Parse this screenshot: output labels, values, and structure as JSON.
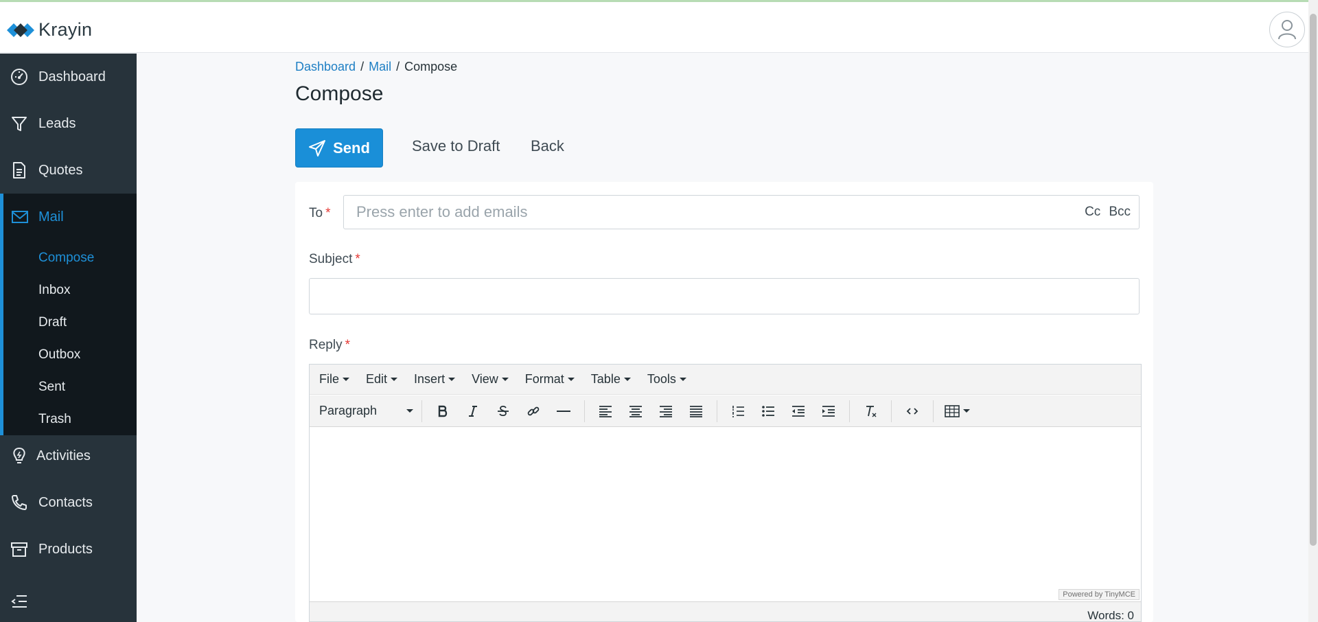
{
  "app": {
    "brand": "Krayin"
  },
  "sidebar": {
    "items": [
      {
        "label": "Dashboard",
        "icon": "dashboard-gauge-icon"
      },
      {
        "label": "Leads",
        "icon": "filter-icon"
      },
      {
        "label": "Quotes",
        "icon": "document-icon"
      },
      {
        "label": "Mail",
        "icon": "mail-icon"
      },
      {
        "label": "Activities",
        "icon": "lightbulb-icon"
      },
      {
        "label": "Contacts",
        "icon": "phone-icon"
      },
      {
        "label": "Products",
        "icon": "archive-box-icon"
      }
    ],
    "mail_sub": [
      "Compose",
      "Inbox",
      "Draft",
      "Outbox",
      "Sent",
      "Trash"
    ],
    "active_sub": "Compose"
  },
  "breadcrumb": {
    "home": "Dashboard",
    "section": "Mail",
    "current": "Compose",
    "sep": "/"
  },
  "page": {
    "title": "Compose"
  },
  "actions": {
    "send": "Send",
    "save_draft": "Save to Draft",
    "back": "Back"
  },
  "form": {
    "to_label": "To",
    "to_placeholder": "Press enter to add emails",
    "cc": "Cc",
    "bcc": "Bcc",
    "subject_label": "Subject",
    "subject_value": "",
    "reply_label": "Reply",
    "required_mark": "*"
  },
  "editor": {
    "menus": [
      "File",
      "Edit",
      "Insert",
      "View",
      "Format",
      "Table",
      "Tools"
    ],
    "block_format": "Paragraph",
    "powered_by": "Powered by TinyMCE",
    "word_count": "Words: 0"
  },
  "colors": {
    "accent": "#1a8fd8",
    "sidebar_bg": "#27333b",
    "sidebar_active_bg": "#11181d",
    "required": "#e53935"
  }
}
